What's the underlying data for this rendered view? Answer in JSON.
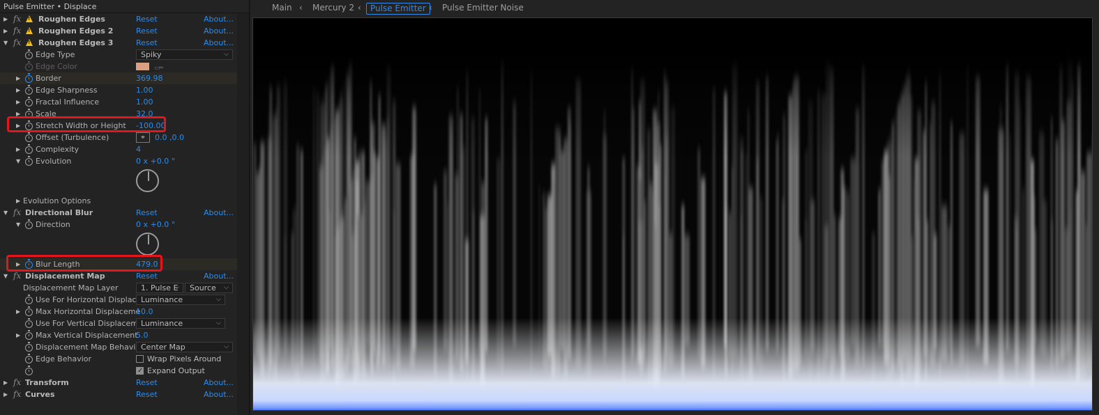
{
  "panel": {
    "title": "Pulse Emitter • Displace",
    "effects": [
      {
        "name": "Roughen Edges",
        "reset": "Reset",
        "about": "About..."
      },
      {
        "name": "Roughen Edges 2",
        "reset": "Reset",
        "about": "About..."
      },
      {
        "name": "Roughen Edges 3",
        "reset": "Reset",
        "about": "About..."
      },
      {
        "name": "Directional Blur",
        "reset": "Reset",
        "about": "About..."
      },
      {
        "name": "Displacement Map",
        "reset": "Reset",
        "about": "About..."
      },
      {
        "name": "Transform",
        "reset": "Reset",
        "about": "About..."
      },
      {
        "name": "Curves",
        "reset": "Reset",
        "about": "About..."
      }
    ],
    "roughen3": {
      "edge_type": {
        "label": "Edge Type",
        "value": "Spiky"
      },
      "edge_color": {
        "label": "Edge Color",
        "color": "#d9a083"
      },
      "border": {
        "label": "Border",
        "value": "369.98"
      },
      "edge_sharpness": {
        "label": "Edge Sharpness",
        "value": "1.00"
      },
      "fractal_influence": {
        "label": "Fractal Influence",
        "value": "1.00"
      },
      "scale": {
        "label": "Scale",
        "value": "32.0"
      },
      "stretch": {
        "label": "Stretch Width or Height",
        "value": "-100.00"
      },
      "offset": {
        "label": "Offset (Turbulence)",
        "value": "0.0 ,0.0"
      },
      "complexity": {
        "label": "Complexity",
        "value": "4"
      },
      "evolution": {
        "label": "Evolution",
        "value": "0 x +0.0 °"
      },
      "evolution_options": {
        "label": "Evolution Options"
      }
    },
    "dirblur": {
      "direction": {
        "label": "Direction",
        "value": "0 x +0.0 °"
      },
      "blur_length": {
        "label": "Blur Length",
        "value": "479.0"
      }
    },
    "dispmap": {
      "layer": {
        "label": "Displacement Map Layer",
        "value": "1. Pulse E",
        "source": "Source"
      },
      "use_h": {
        "label": "Use For Horizontal Displace",
        "value": "Luminance"
      },
      "max_h": {
        "label": "Max Horizontal Displaceme",
        "value": "10.0"
      },
      "use_v": {
        "label": "Use For Vertical Displacem",
        "value": "Luminance"
      },
      "max_v": {
        "label": "Max Vertical Displacement",
        "value": "5.0"
      },
      "behavior": {
        "label": "Displacement Map Behavio",
        "value": "Center Map"
      },
      "edge_behavior": {
        "label": "Edge Behavior",
        "wrap_label": "Wrap Pixels Around",
        "wrap_checked": false
      },
      "expand": {
        "label": "Expand Output",
        "checked": true
      }
    }
  },
  "viewer": {
    "breadcrumbs": [
      "Main",
      "Mercury 2",
      "Pulse Emitter",
      "Pulse Emitter Noise"
    ],
    "active_index": 2
  },
  "colors": {
    "accent": "#2d8ceb",
    "highlight": "#e8141b",
    "warning": "#f2c01a",
    "glow": "#2a62ff"
  }
}
